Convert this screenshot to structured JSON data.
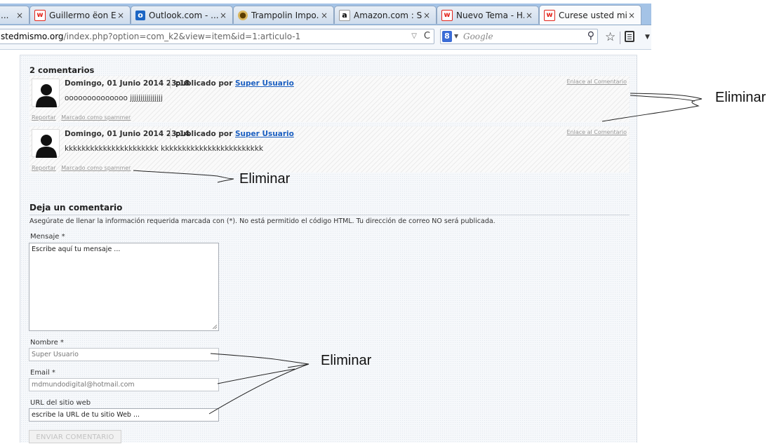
{
  "browser": {
    "tabs": [
      {
        "favicon": "w-icon",
        "label": "",
        "close": "×"
      },
      {
        "favicon": "w-icon",
        "label": "Guillermo ëon Es...",
        "close": "×"
      },
      {
        "favicon": "outlook-icon",
        "label": "Outlook.com - ...",
        "close": "×"
      },
      {
        "favicon": "trampolin-icon",
        "label": "Trampolin Impo...",
        "close": "×"
      },
      {
        "favicon": "amazon-icon",
        "label": "Amazon.com : S...",
        "close": "×"
      },
      {
        "favicon": "w-icon",
        "label": "Nuevo Tema - H...",
        "close": "×"
      },
      {
        "favicon": "w-icon",
        "label": "Curese usted mi...",
        "close": "×"
      }
    ],
    "first_tab_label": "...",
    "url_host": "stedmismo.org",
    "url_path": "/index.php?option=com_k2&view=item&id=1:articulo-1",
    "search_placeholder": "Google",
    "search_engine_letter": "8"
  },
  "comments": {
    "title": "2 comentarios",
    "items": [
      {
        "date": "Domingo, 01 Junio 2014 23:18",
        "published_by": "publicado por",
        "author": "Super Usuario",
        "text": "oooooooooooooo jjjjjjjjjjjjjjjj",
        "link": "Enlace al Comentario",
        "report": "Reportar",
        "spam": "Marcado como spammer"
      },
      {
        "date": "Domingo, 01 Junio 2014 23:14",
        "published_by": "publicado por",
        "author": "Super Usuario",
        "text": "kkkkkkkkkkkkkkkkkkkkkk kkkkkkkkkkkkkkkkkkkkkkkk",
        "link": "Enlace al Comentario",
        "report": "Reportar",
        "spam": "Marcado como spammer"
      }
    ]
  },
  "form": {
    "title": "Deja un comentario",
    "note": "Asegúrate de llenar la información requerida marcada con (*). No está permitido el código HTML. Tu dirección de correo NO será publicada.",
    "message_label": "Mensaje *",
    "message_value": "Escribe aquí tu mensaje ...",
    "name_label": "Nombre *",
    "name_value": "Super Usuario",
    "email_label": "Email *",
    "email_value": "mdmundodigital@hotmail.com",
    "url_label": "URL del sitio web",
    "url_value": "escribe la URL de tu sitio Web ...",
    "submit_label": "ENVIAR COMENTARIO"
  },
  "annotations": {
    "label_top": "Eliminar",
    "label_middle": "Eliminar",
    "label_bottom": "Eliminar"
  }
}
